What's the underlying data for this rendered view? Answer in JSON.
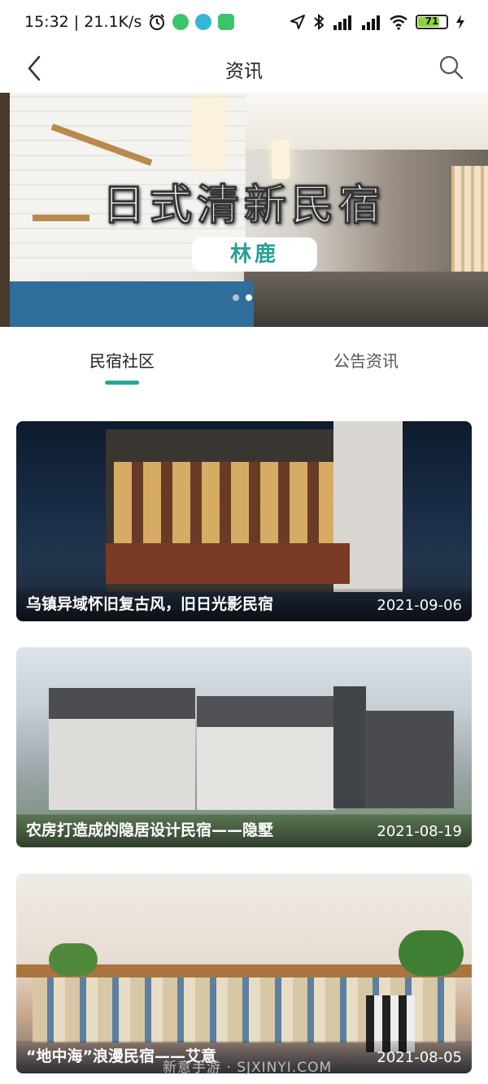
{
  "status_bar": {
    "time_speed": "15:32 | 21.1K/s",
    "battery": "71"
  },
  "nav": {
    "title": "资讯"
  },
  "banner": {
    "title": "日式清新民宿",
    "tag": "林鹿"
  },
  "tabs": [
    {
      "label": "民宿社区"
    },
    {
      "label": "公告资讯"
    }
  ],
  "articles": [
    {
      "title": "乌镇异域怀旧复古风，旧日光影民宿",
      "date": "2021-09-06"
    },
    {
      "title": "农房打造成的隐居设计民宿——隐墅",
      "date": "2021-08-19"
    },
    {
      "title": "“地中海”浪漫民宿——艾意",
      "date": "2021-08-05"
    }
  ],
  "watermark": "新意手游 · SJXINYI.COM",
  "colors": {
    "accent": "#26a69a",
    "tag_text": "#2aa096",
    "battery_fill": "#8ed13f"
  }
}
